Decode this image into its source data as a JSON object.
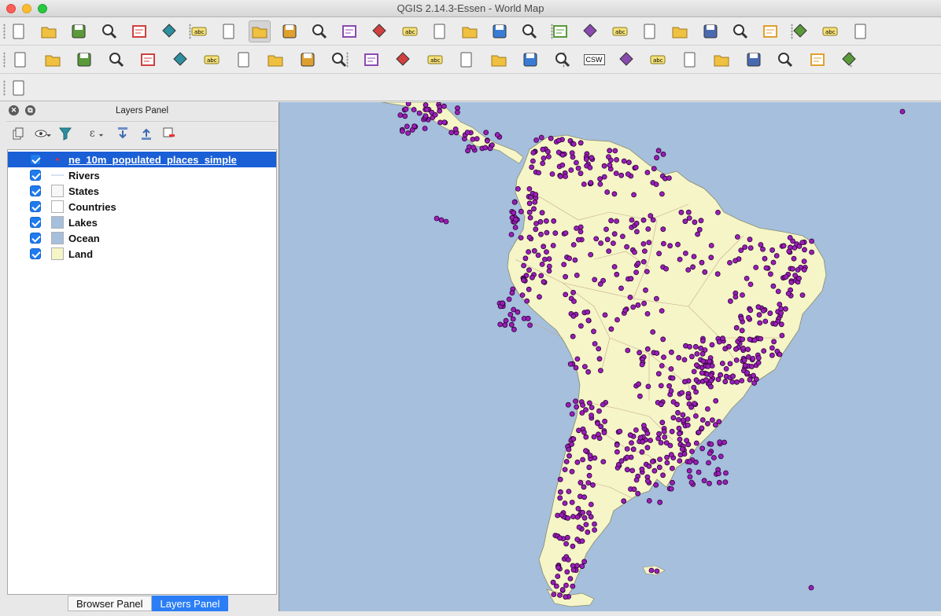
{
  "window": {
    "title": "QGIS 2.14.3-Essen - World Map"
  },
  "toolbar_icons": {
    "row1": [
      "new-project-icon",
      "open-project-icon",
      "save-project-icon",
      "save-as-icon",
      "new-print-composer-icon",
      "composer-manager-icon",
      "pan-icon",
      "pan-to-selection-icon",
      "zoom-in-icon",
      "zoom-out-icon",
      "zoom-native-icon",
      "zoom-full-icon",
      "zoom-to-selection-icon",
      "zoom-to-layer-icon",
      "zoom-last-icon",
      "zoom-next-icon",
      "refresh-icon",
      "identify-icon",
      "action-icon",
      "select-features-icon",
      "select-by-expression-icon",
      "deselect-icon",
      "attribute-table-icon",
      "field-calculator-icon",
      "statistics-icon",
      "measure-icon",
      "map-tips-icon",
      "new-bookmark-icon",
      "show-bookmarks-icon"
    ],
    "row2": [
      "current-edits-icon",
      "toggle-editing-icon",
      "save-edits-icon",
      "add-feature-icon",
      "move-feature-icon",
      "node-tool-icon",
      "delete-selected-icon",
      "cut-features-icon",
      "copy-features-icon",
      "paste-features-icon",
      "label-icon",
      "pin-labels-icon",
      "highlight-pinned-icon",
      "show-hide-labels-icon",
      "move-label-icon",
      "rotate-label-icon",
      "change-label-icon",
      "georeferencer-icon",
      "metasearch-icon",
      "python-console-icon",
      "dbmanager-icon",
      "processing-icon",
      "osm-icon",
      "plugin-icon",
      "vertex-icon",
      "raster-calc-icon",
      "geoserver-icon"
    ],
    "row3": [
      "digitize-icon"
    ]
  },
  "csw_label": "CSW",
  "layers_panel": {
    "title": "Layers Panel",
    "layers": [
      {
        "name": "ne_10m_populated_places_simple",
        "checked": true,
        "selected": true,
        "symbol": "point",
        "color": "#e03030"
      },
      {
        "name": "Rivers",
        "checked": true,
        "selected": false,
        "symbol": "line",
        "color": "#a9c6e6"
      },
      {
        "name": "States",
        "checked": true,
        "selected": false,
        "symbol": "fill",
        "color": "#f7f7f7"
      },
      {
        "name": "Countries",
        "checked": true,
        "selected": false,
        "symbol": "fill",
        "color": "#ffffff"
      },
      {
        "name": "Lakes",
        "checked": true,
        "selected": false,
        "symbol": "fill",
        "color": "#a5bfdd"
      },
      {
        "name": "Ocean",
        "checked": true,
        "selected": false,
        "symbol": "fill",
        "color": "#a5bfdd"
      },
      {
        "name": "Land",
        "checked": true,
        "selected": false,
        "symbol": "fill",
        "color": "#f5f5c8"
      }
    ],
    "tabs": [
      {
        "label": "Browser Panel",
        "active": false
      },
      {
        "label": "Layers Panel",
        "active": true
      }
    ]
  },
  "map": {
    "ocean_color": "#a5bfdd",
    "land_color": "#f5f5c8",
    "point_color": "#9a1fb8",
    "point_stroke": "#2b0033"
  }
}
